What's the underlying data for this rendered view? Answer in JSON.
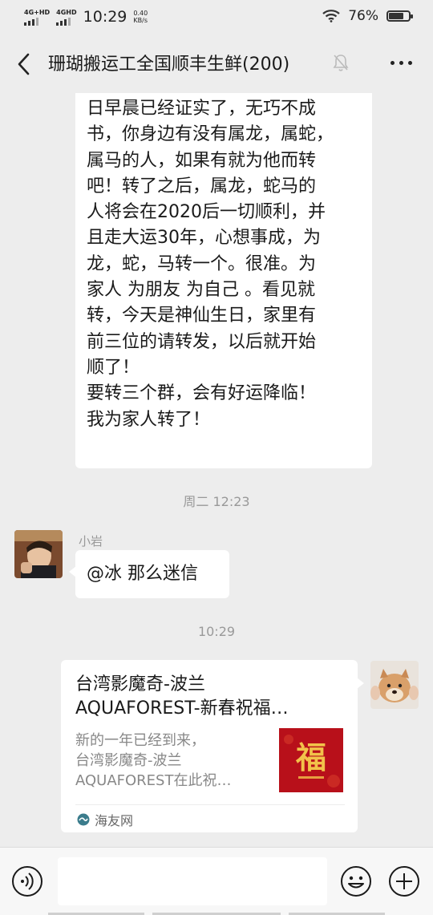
{
  "status_bar": {
    "sim1": "4G+HD",
    "sim2": "4GHD",
    "time": "10:29",
    "speed_value": "0.40",
    "speed_unit": "KB/s",
    "battery": "76%",
    "battery_level": 0.76
  },
  "header": {
    "title": "珊瑚搬运工全国顺丰生鲜(200)",
    "back_icon": "chevron-left-icon",
    "mute_icon": "bell-off-icon",
    "more_icon": "more-icon"
  },
  "messages": {
    "forward_text": "日早晨已经证实了，无巧不成\n书，你身边有没有属龙，属蛇，\n属马的人，如果有就为他而转\n吧！转了之后，属龙，蛇马的\n人将会在2020后一切顺利，并\n且走大运30年，心想事成，为\n龙，蛇，马转一个。很准。为\n家人 为朋友 为自己 。看见就\n转，今天是神仙生日，家里有\n前三位的请转发，以后就开始\n顺了！\n要转三个群，会有好运降临！\n我为家人转了！",
    "timestamp1": "周二 12:23",
    "sender_name": "小岩",
    "reply_text": "@冰  那么迷信",
    "timestamp2": "10:29"
  },
  "link_card": {
    "title_line1": "台湾影魔奇-波兰",
    "title_line2": "AQUAFOREST-新春祝福…",
    "desc_line1": "新的一年已经到来，",
    "desc_line2": "台湾影魔奇-波兰",
    "desc_line3": "AQUAFOREST在此祝…",
    "thumb_char": "福",
    "source": "海友网",
    "colors": {
      "thumb_bg": "#b8101a",
      "thumb_char": "#f2c24a"
    }
  },
  "input_bar": {
    "voice_icon": "voice-icon",
    "emoji_icon": "emoji-icon",
    "plus_icon": "plus-icon"
  }
}
